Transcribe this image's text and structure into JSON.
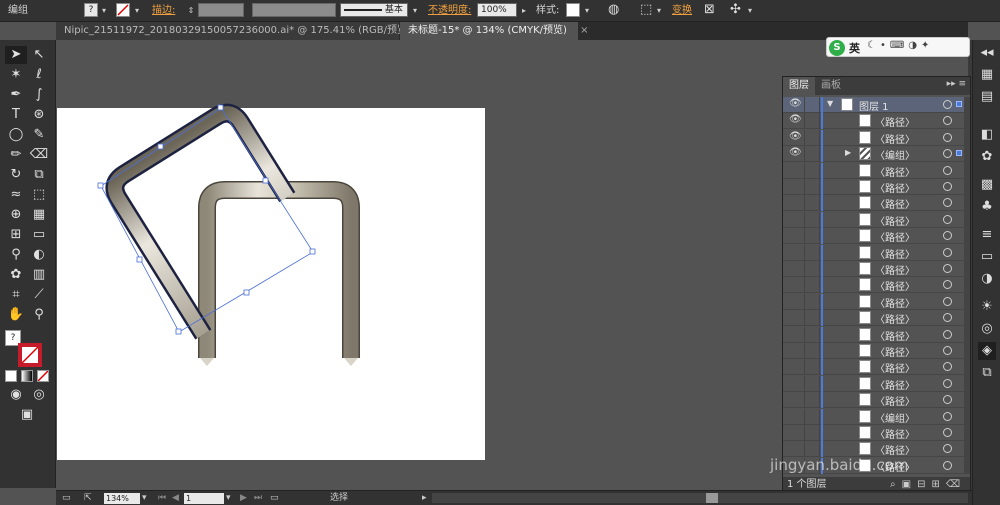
{
  "control_bar": {
    "selection_label": "编组",
    "stroke_label": "描边:",
    "stroke_style_label": "基本",
    "opacity_label": "不透明度:",
    "opacity_value": "100%",
    "style_label": "样式:",
    "transform_label": "变换"
  },
  "tabs": [
    {
      "label": "Nipic_21511972_20180329150057236000.ai* @ 175.41% (RGB/预览)"
    },
    {
      "label": "未标题-15* @ 134% (CMYK/预览)"
    }
  ],
  "ime": {
    "logo": "S",
    "label": "英"
  },
  "layers_panel": {
    "tabs": [
      "图层",
      "画板"
    ],
    "layer_name": "图层 1",
    "rows": [
      {
        "name": "〈路径〉",
        "visible": true,
        "thumb": "rect"
      },
      {
        "name": "〈路径〉",
        "visible": true,
        "thumb": "rect"
      },
      {
        "name": "〈编组〉",
        "visible": true,
        "thumb": "stripe",
        "expandable": true,
        "selected": true
      },
      {
        "name": "〈路径〉",
        "visible": false,
        "thumb": "rect"
      },
      {
        "name": "〈路径〉",
        "visible": false,
        "thumb": "rect"
      },
      {
        "name": "〈路径〉",
        "visible": false,
        "thumb": "rect"
      },
      {
        "name": "〈路径〉",
        "visible": false,
        "thumb": "rect"
      },
      {
        "name": "〈路径〉",
        "visible": false,
        "thumb": "rect"
      },
      {
        "name": "〈路径〉",
        "visible": false,
        "thumb": "rect"
      },
      {
        "name": "〈路径〉",
        "visible": false,
        "thumb": "rect"
      },
      {
        "name": "〈路径〉",
        "visible": false,
        "thumb": "rect"
      },
      {
        "name": "〈路径〉",
        "visible": false,
        "thumb": "rect"
      },
      {
        "name": "〈路径〉",
        "visible": false,
        "thumb": "rect"
      },
      {
        "name": "〈路径〉",
        "visible": false,
        "thumb": "rect"
      },
      {
        "name": "〈路径〉",
        "visible": false,
        "thumb": "rect"
      },
      {
        "name": "〈路径〉",
        "visible": false,
        "thumb": "rect"
      },
      {
        "name": "〈路径〉",
        "visible": false,
        "thumb": "rect"
      },
      {
        "name": "〈路径〉",
        "visible": false,
        "thumb": "rect"
      },
      {
        "name": "〈编组〉",
        "visible": false,
        "thumb": "rect"
      },
      {
        "name": "〈路径〉",
        "visible": false,
        "thumb": "rect"
      },
      {
        "name": "〈路径〉",
        "visible": false,
        "thumb": "rect"
      },
      {
        "name": "〈路径〉",
        "visible": false,
        "thumb": "rect"
      }
    ],
    "footer_label": "1 个图层"
  },
  "status_bar": {
    "zoom": "134%",
    "page": "1",
    "mode_label": "选择"
  },
  "watermark": "jingyan.baidu.com",
  "colors": {
    "accent": "#4a7bd8",
    "transform_link": "#f0a040"
  }
}
